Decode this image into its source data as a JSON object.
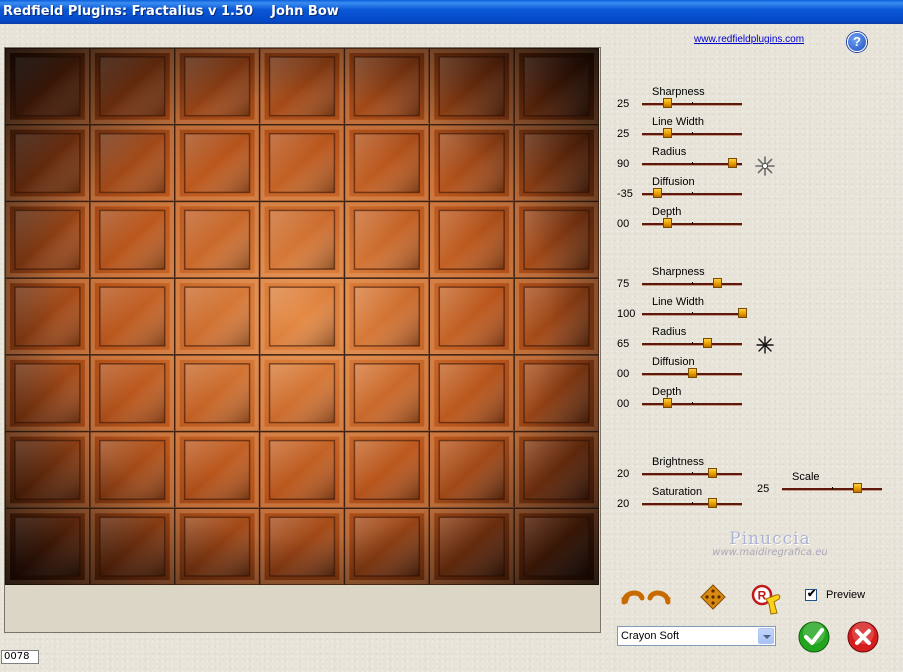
{
  "window": {
    "title": "Redfield Plugins: Fractalius v 1.50    John Bow"
  },
  "header": {
    "link_text": "www.redfieldplugins.com",
    "help_symbol": "?"
  },
  "group1": {
    "sliders": [
      {
        "label": "Sharpness",
        "value": "25",
        "level": 0.25
      },
      {
        "label": "Line Width",
        "value": "25",
        "level": 0.25
      },
      {
        "label": "Radius",
        "value": "90",
        "level": 0.9
      },
      {
        "label": "Diffusion",
        "value": "-35",
        "level": 0.15
      },
      {
        "label": "Depth",
        "value": "00",
        "level": 0.25
      }
    ]
  },
  "group2": {
    "sliders": [
      {
        "label": "Sharpness",
        "value": "75",
        "level": 0.75
      },
      {
        "label": "Line Width",
        "value": "100",
        "level": 1.0
      },
      {
        "label": "Radius",
        "value": "65",
        "level": 0.65
      },
      {
        "label": "Diffusion",
        "value": "00",
        "level": 0.5
      },
      {
        "label": "Depth",
        "value": "00",
        "level": 0.25
      }
    ]
  },
  "group3": {
    "sliders": [
      {
        "label": "Brightness",
        "value": "20",
        "level": 0.7
      },
      {
        "label": "Saturation",
        "value": "20",
        "level": 0.7
      }
    ],
    "scale": {
      "label": "Scale",
      "value": "25",
      "level": 0.75
    }
  },
  "watermark": {
    "name": "Pinuccia",
    "site": "www.maidiregrafica.eu"
  },
  "controls": {
    "preview_label": "Preview",
    "preview_checked": "✔",
    "preset_value": "Crayon Soft",
    "status_value": "0078"
  },
  "colors": {
    "titlebar": "#0a58d8",
    "track": "#5d1a0c",
    "thumb": "#e8a000",
    "ok_green": "#22a51e",
    "cancel_red": "#d61d1d"
  },
  "icons": {
    "undo_redo": "undo-redo-icon",
    "randomize": "diamond-randomize-icon",
    "reset": "reset-hand-icon",
    "ok": "checkmark-icon",
    "cancel": "x-icon",
    "burst": "starburst-icon"
  }
}
